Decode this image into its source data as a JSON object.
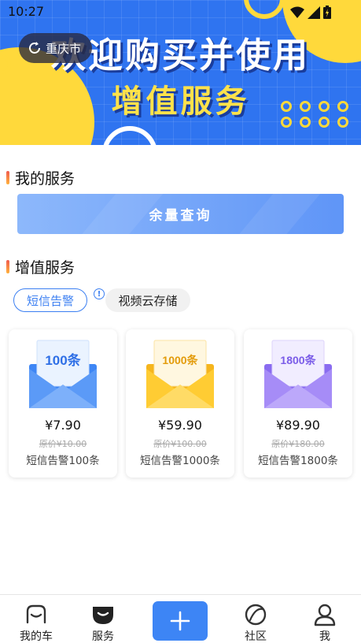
{
  "status_bar": {
    "time": "10:27"
  },
  "banner": {
    "headline": "欢迎购买并使用",
    "subheadline": "增值服务",
    "city_label": "重庆市"
  },
  "my_services": {
    "title": "我的服务",
    "query_button": "余量查询"
  },
  "value_added": {
    "title": "增值服务",
    "tabs": [
      {
        "label": "短信告警",
        "active": true
      },
      {
        "label": "视频云存储",
        "active": false
      }
    ]
  },
  "products": [
    {
      "badge": "100条",
      "price": "¥7.90",
      "original_price": "原价¥10.00",
      "name": "短信告警100条",
      "color": "#4a90f7"
    },
    {
      "badge": "1000条",
      "price": "¥59.90",
      "original_price": "原价¥100.00",
      "name": "短信告警1000条",
      "color": "#ffc628"
    },
    {
      "badge": "1800条",
      "price": "¥89.90",
      "original_price": "原价¥180.00",
      "name": "短信告警1800条",
      "color": "#9b7df5"
    }
  ],
  "bottom_nav": {
    "items": [
      {
        "label": "我的车",
        "icon": "car-icon"
      },
      {
        "label": "服务",
        "icon": "service-icon"
      },
      {
        "label": "",
        "icon": "plus-icon"
      },
      {
        "label": "社区",
        "icon": "community-icon"
      },
      {
        "label": "我",
        "icon": "user-icon"
      }
    ]
  },
  "colors": {
    "accent": "#3b7ff2",
    "banner_blue": "#2f74f0",
    "banner_yellow": "#ffd93b"
  }
}
